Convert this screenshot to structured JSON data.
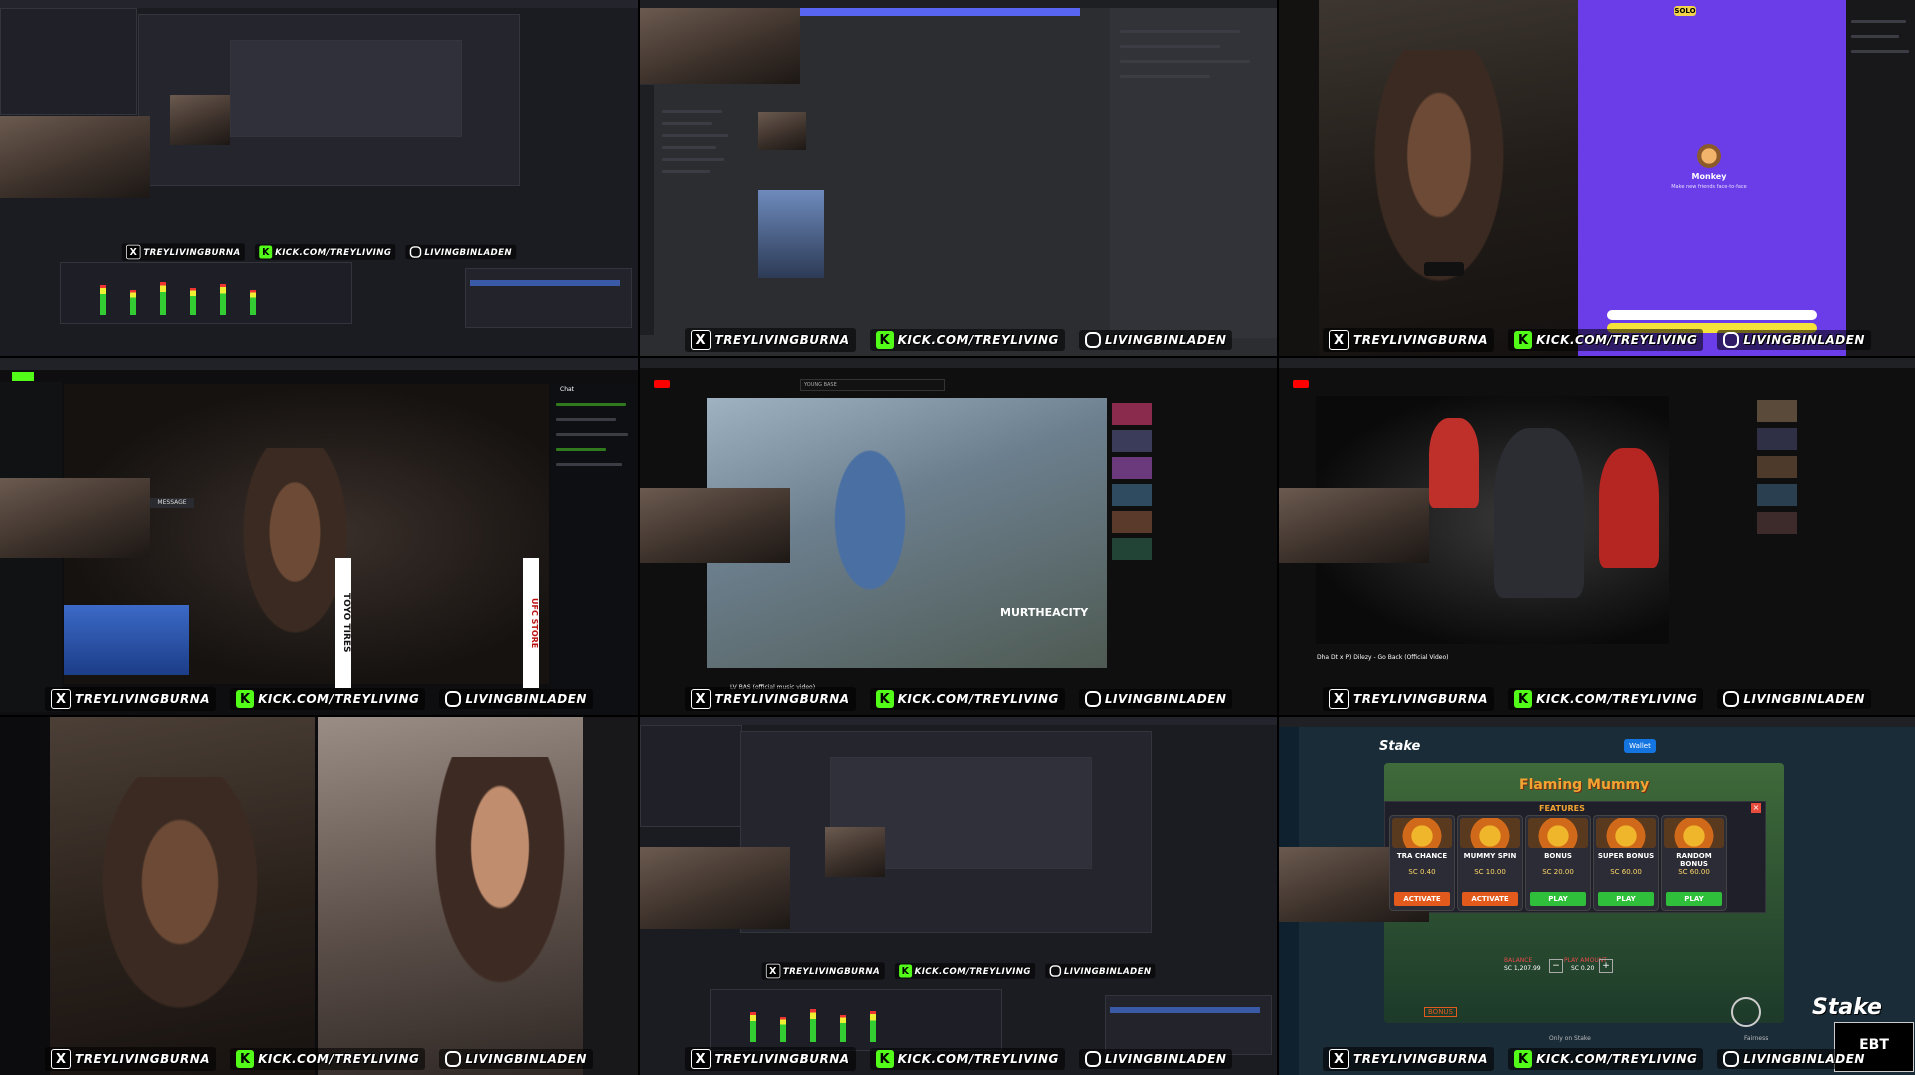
{
  "overlay": {
    "x_handle": "TREYLIVINGBURNA",
    "kick_handle": "KICK.COM/TREYLIVING",
    "ig_handle": "LIVINGBINLADEN"
  },
  "tile3": {
    "badge_solo": "SOLO",
    "app_name": "Monkey",
    "tagline": "Make new friends face-to-face"
  },
  "tile4": {
    "message_label": "MESSAGE",
    "sponsor1": "TOYO TIRES",
    "sponsor2": "UFC STORE",
    "chat_label": "Chat"
  },
  "tile5": {
    "watermark": "MURTHEACITY",
    "video_title": "LV BAS (official music video)",
    "search": "YOUNG BASE"
  },
  "tile6": {
    "video_title": "Dha Dt x P) Dilezy - Go Back (Official Video)"
  },
  "tile9": {
    "brand": "Stake",
    "game_title": "Flaming Mummy",
    "features_title": "FEATURES",
    "wallet_label": "Wallet",
    "balance_label": "BALANCE",
    "balance_value": "SC 1,207.99",
    "play_amount_label": "PLAY AMOUNT",
    "play_amount_value": "SC 0.20",
    "only_on": "Only on Stake",
    "fairness": "Fairness",
    "bonus_label": "BONUS",
    "ebt": "EBT",
    "features": [
      {
        "name": "TRA CHANCE",
        "price": "SC 0.40",
        "action": "ACTIVATE"
      },
      {
        "name": "MUMMY SPIN",
        "price": "SC 10.00",
        "action": "ACTIVATE"
      },
      {
        "name": "BONUS",
        "price": "SC 20.00",
        "action": "PLAY"
      },
      {
        "name": "SUPER BONUS",
        "price": "SC 60.00",
        "action": "PLAY"
      },
      {
        "name": "RANDOM BONUS",
        "price": "SC 60.00",
        "action": "PLAY"
      }
    ]
  },
  "colors": {
    "kick_green": "#53fc18",
    "twitch_purple": "#6a3de8",
    "stake_blue": "#1475e1"
  }
}
